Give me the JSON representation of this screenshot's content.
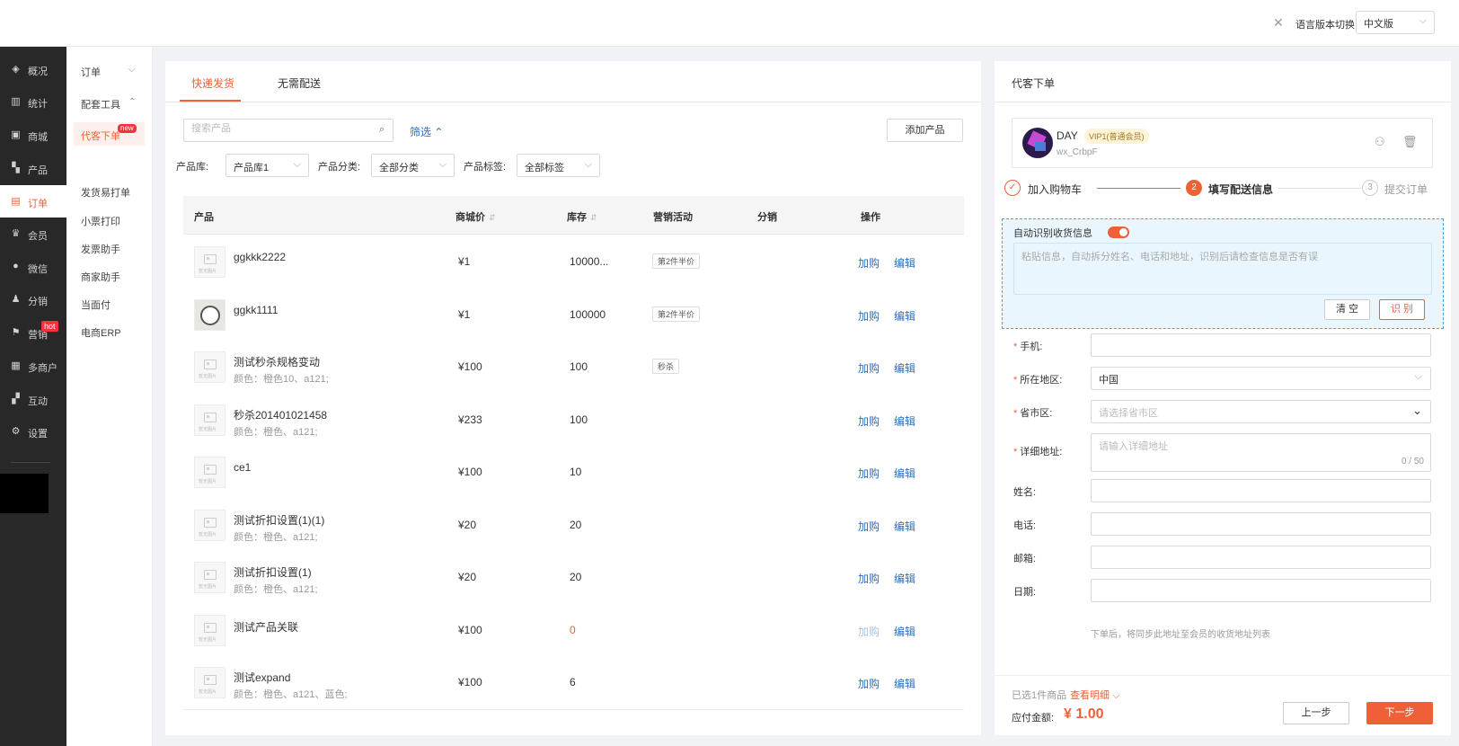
{
  "topbar": {
    "close_icon": "✕",
    "lang_label": "语言版本切换:",
    "lang_value": "中文版"
  },
  "sidebar": {
    "items": [
      {
        "icon": "layers-icon",
        "label": "概况"
      },
      {
        "icon": "stats-icon",
        "label": "统计"
      },
      {
        "icon": "shop-icon",
        "label": "商城"
      },
      {
        "icon": "grid-icon",
        "label": "产品"
      },
      {
        "icon": "order-icon",
        "label": "订单"
      },
      {
        "icon": "crown-icon",
        "label": "会员"
      },
      {
        "icon": "wechat-icon",
        "label": "微信"
      },
      {
        "icon": "share-icon",
        "label": "分销"
      },
      {
        "icon": "flag-icon",
        "label": "营销"
      },
      {
        "icon": "merchant-icon",
        "label": "多商户"
      },
      {
        "icon": "interact-icon",
        "label": "互动"
      },
      {
        "icon": "gear-icon",
        "label": "设置"
      }
    ],
    "active_index": 4,
    "hot_badge": "hot"
  },
  "submenu": {
    "items": [
      "订单",
      "配套工具",
      "代客下单",
      "发货易打单",
      "小票打印",
      "发票助手",
      "商家助手",
      "当面付",
      "电商ERP"
    ],
    "new_badge": "new"
  },
  "main": {
    "tabs": [
      "快递发货",
      "无需配送"
    ],
    "search_placeholder": "搜索产品",
    "filter_label": "筛选",
    "add_button": "添加产品",
    "filters": [
      {
        "label": "产品库:",
        "value": "产品库1"
      },
      {
        "label": "产品分类:",
        "value": "全部分类"
      },
      {
        "label": "产品标签:",
        "value": "全部标签"
      }
    ],
    "columns": [
      "产品",
      "商城价",
      "库存",
      "营销活动",
      "分销",
      "操作"
    ],
    "rows": [
      {
        "name": "ggkkk2222",
        "sub": "",
        "price": "¥1",
        "stock": "10000...",
        "tag": "第2件半价",
        "buy": "加购",
        "edit": "编辑",
        "img": "placeholder"
      },
      {
        "name": "ggkk1111",
        "sub": "",
        "price": "¥1",
        "stock": "100000",
        "tag": "第2件半价",
        "buy": "加购",
        "edit": "编辑",
        "img": "dog"
      },
      {
        "name": "测试秒杀规格变动",
        "sub": "颜色：橙色10、a121;",
        "price": "¥100",
        "stock": "100",
        "tag": "秒杀",
        "buy": "加购",
        "edit": "编辑",
        "img": "placeholder"
      },
      {
        "name": "秒杀201401021458",
        "sub": "颜色：橙色、a121;",
        "price": "¥233",
        "stock": "100",
        "tag": "",
        "buy": "加购",
        "edit": "编辑",
        "img": "placeholder"
      },
      {
        "name": "ce1",
        "sub": "",
        "price": "¥100",
        "stock": "10",
        "tag": "",
        "buy": "加购",
        "edit": "编辑",
        "img": "placeholder"
      },
      {
        "name": "测试折扣设置(1)(1)",
        "sub": "颜色：橙色、a121;",
        "price": "¥20",
        "stock": "20",
        "tag": "",
        "buy": "加购",
        "edit": "编辑",
        "img": "placeholder"
      },
      {
        "name": "测试折扣设置(1)",
        "sub": "颜色：橙色、a121;",
        "price": "¥20",
        "stock": "20",
        "tag": "",
        "buy": "加购",
        "edit": "编辑",
        "img": "placeholder"
      },
      {
        "name": "测试产品关联",
        "sub": "",
        "price": "¥100",
        "stock": "0",
        "tag": "",
        "buy": "加购",
        "edit": "编辑",
        "img": "placeholder",
        "disabled": true
      },
      {
        "name": "测试expand",
        "sub": "颜色：橙色、a121、蓝色;",
        "price": "¥100",
        "stock": "6",
        "tag": "",
        "buy": "加购",
        "edit": "编辑",
        "img": "placeholder"
      }
    ],
    "img_placeholder_text": "暂无图片"
  },
  "order": {
    "title": "代客下单",
    "member": {
      "name": "DAY",
      "vip": "VIP1(普通会员)",
      "id": "wx_CrbpF"
    },
    "steps": [
      {
        "num": "✓",
        "label": "加入购物车"
      },
      {
        "num": "2",
        "label": "填写配送信息"
      },
      {
        "num": "3",
        "label": "提交订单"
      }
    ],
    "recognize": {
      "label": "自动识别收货信息",
      "placeholder": "粘贴信息，自动拆分姓名、电话和地址，识别后请检查信息是否有误",
      "clear": "清 空",
      "recognize": "识 别"
    },
    "fields": [
      {
        "label": "手机:",
        "required": true,
        "value": "",
        "placeholder": ""
      },
      {
        "label": "所在地区:",
        "required": true,
        "value": "中国",
        "placeholder": ""
      },
      {
        "label": "省市区:",
        "required": true,
        "value": "",
        "placeholder": "请选择省市区"
      },
      {
        "label": "详细地址:",
        "required": true,
        "value": "",
        "placeholder": "请输入详细地址",
        "count": "0 / 50"
      },
      {
        "label": "姓名:",
        "required": false,
        "value": "",
        "placeholder": ""
      },
      {
        "label": "电话:",
        "required": false,
        "value": "",
        "placeholder": ""
      },
      {
        "label": "邮箱:",
        "required": false,
        "value": "",
        "placeholder": ""
      },
      {
        "label": "日期:",
        "required": false,
        "value": "",
        "placeholder": ""
      }
    ],
    "hint": "下单后，将同步此地址至会员的收货地址列表",
    "selected_info": "已选1件商品",
    "view_detail": "查看明细",
    "pay_label": "应付金额:",
    "pay_amount": "¥ 1.00",
    "prev": "上一步",
    "next": "下一步"
  }
}
